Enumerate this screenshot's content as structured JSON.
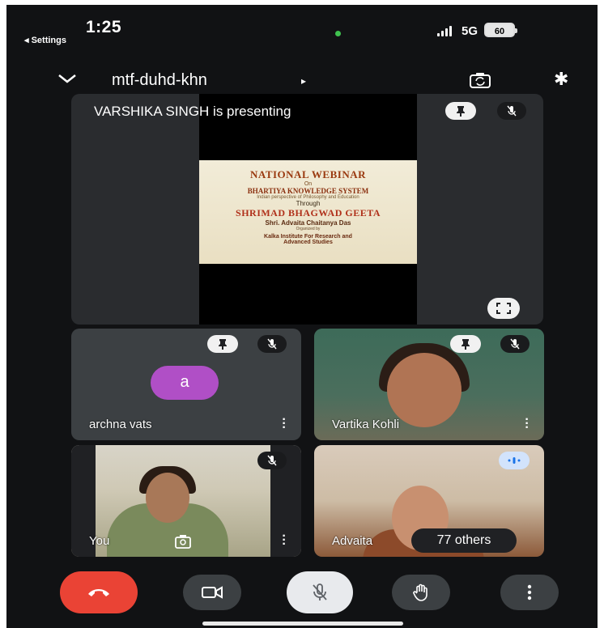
{
  "status_bar": {
    "time": "1:25",
    "back_label": "◂ Settings",
    "network": "5G",
    "battery": "60"
  },
  "header": {
    "meeting_code": "mtf-duhd-khn",
    "arrow": "▸",
    "bluetooth_glyph": "✱"
  },
  "presentation": {
    "label": "VARSHIKA SINGH is presenting",
    "slide": {
      "line1": "NATIONAL WEBINAR",
      "line2": "On",
      "line3": "BHARTIYA KNOWLEDGE SYSTEM",
      "line4": "Indian perspective of Philosophy and Education",
      "line5": "Through",
      "line6": "SHRIMAD BHAGWAD GEETA",
      "line7": "Shri. Advaita Chaitanya Das",
      "line8": "Organized by",
      "line9": "Kalka Institute For Research and",
      "line10": "Advanced Studies"
    }
  },
  "participants": [
    {
      "name": "archna vats",
      "avatar_letter": "a",
      "avatar_color": "#b04fc6"
    },
    {
      "name": "Vartika Kohli"
    },
    {
      "name": "You"
    },
    {
      "name": "Advaita"
    }
  ],
  "others_count": "77 others",
  "controls": {
    "end_call": "end-call",
    "camera": "camera",
    "mic": "microphone-off",
    "raise_hand": "raise-hand",
    "more": "more-options"
  },
  "colors": {
    "background": "#111214",
    "tile": "#3c4043",
    "end_call": "#ea4335",
    "speaking": "#1a73e8"
  }
}
